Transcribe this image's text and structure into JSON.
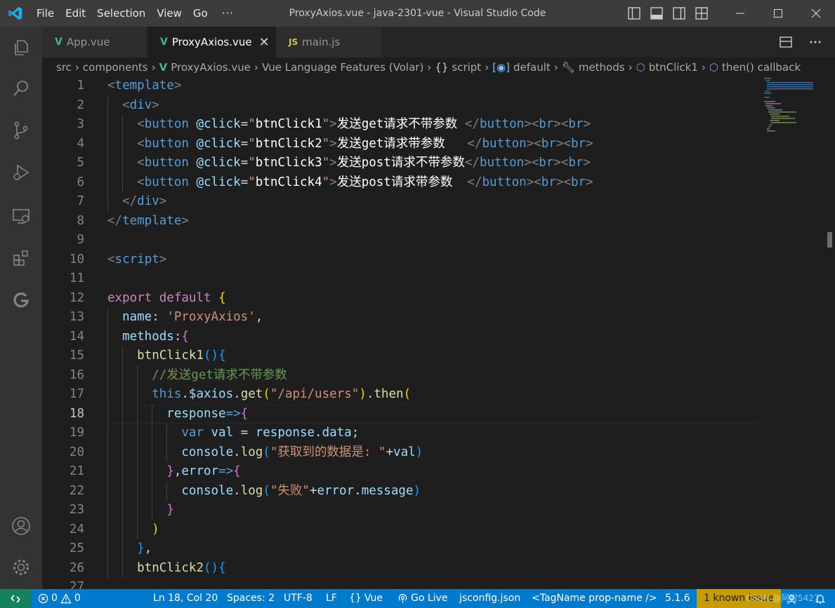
{
  "window": {
    "title": "ProxyAxios.vue - java-2301-vue - Visual Studio Code",
    "menu": [
      "File",
      "Edit",
      "Selection",
      "View",
      "Go",
      "···"
    ]
  },
  "tabs": [
    {
      "label": "App.vue",
      "icon": "vue-icon",
      "active": false
    },
    {
      "label": "ProxyAxios.vue",
      "icon": "vue-icon",
      "active": true,
      "close": "✕"
    },
    {
      "label": "main.js",
      "icon": "js-icon",
      "active": false
    }
  ],
  "breadcrumb": [
    "src",
    "components",
    "ProxyAxios.vue",
    "Vue Language Features (Volar)",
    "script",
    "default",
    "methods",
    "btnClick1",
    "then() callback"
  ],
  "editor": {
    "current_line": 18,
    "lines": [
      {
        "n": "1",
        "tokens": [
          [
            "t-punc",
            "<"
          ],
          [
            "t-tag",
            "template"
          ],
          [
            "t-punc",
            ">"
          ]
        ]
      },
      {
        "n": "2",
        "tokens": [
          [
            "t-op",
            "  "
          ],
          [
            "t-punc",
            "<"
          ],
          [
            "t-tag",
            "div"
          ],
          [
            "t-punc",
            ">"
          ]
        ]
      },
      {
        "n": "3",
        "tokens": [
          [
            "t-op",
            "    "
          ],
          [
            "t-punc",
            "<"
          ],
          [
            "t-tag",
            "button"
          ],
          [
            "t-op",
            " "
          ],
          [
            "t-attr",
            "@click"
          ],
          [
            "t-op",
            "="
          ],
          [
            "t-str",
            "\""
          ],
          [
            "t-txt",
            "btnClick1"
          ],
          [
            "t-str",
            "\""
          ],
          [
            "t-punc",
            ">"
          ],
          [
            "t-txt",
            "发送get请求不带参数 "
          ],
          [
            "t-punc",
            "</"
          ],
          [
            "t-tag",
            "button"
          ],
          [
            "t-punc",
            "><"
          ],
          [
            "t-tag",
            "br"
          ],
          [
            "t-punc",
            "><"
          ],
          [
            "t-tag",
            "br"
          ],
          [
            "t-punc",
            ">"
          ]
        ]
      },
      {
        "n": "4",
        "tokens": [
          [
            "t-op",
            "    "
          ],
          [
            "t-punc",
            "<"
          ],
          [
            "t-tag",
            "button"
          ],
          [
            "t-op",
            " "
          ],
          [
            "t-attr",
            "@click"
          ],
          [
            "t-op",
            "="
          ],
          [
            "t-str",
            "\""
          ],
          [
            "t-txt",
            "btnClick2"
          ],
          [
            "t-str",
            "\""
          ],
          [
            "t-punc",
            ">"
          ],
          [
            "t-txt",
            "发送get请求带参数   "
          ],
          [
            "t-punc",
            "</"
          ],
          [
            "t-tag",
            "button"
          ],
          [
            "t-punc",
            "><"
          ],
          [
            "t-tag",
            "br"
          ],
          [
            "t-punc",
            "><"
          ],
          [
            "t-tag",
            "br"
          ],
          [
            "t-punc",
            ">"
          ]
        ]
      },
      {
        "n": "5",
        "tokens": [
          [
            "t-op",
            "    "
          ],
          [
            "t-punc",
            "<"
          ],
          [
            "t-tag",
            "button"
          ],
          [
            "t-op",
            " "
          ],
          [
            "t-attr",
            "@click"
          ],
          [
            "t-op",
            "="
          ],
          [
            "t-str",
            "\""
          ],
          [
            "t-txt",
            "btnClick3"
          ],
          [
            "t-str",
            "\""
          ],
          [
            "t-punc",
            ">"
          ],
          [
            "t-txt",
            "发送post请求不带参数"
          ],
          [
            "t-punc",
            "</"
          ],
          [
            "t-tag",
            "button"
          ],
          [
            "t-punc",
            "><"
          ],
          [
            "t-tag",
            "br"
          ],
          [
            "t-punc",
            "><"
          ],
          [
            "t-tag",
            "br"
          ],
          [
            "t-punc",
            ">"
          ]
        ]
      },
      {
        "n": "6",
        "tokens": [
          [
            "t-op",
            "    "
          ],
          [
            "t-punc",
            "<"
          ],
          [
            "t-tag",
            "button"
          ],
          [
            "t-op",
            " "
          ],
          [
            "t-attr",
            "@click"
          ],
          [
            "t-op",
            "="
          ],
          [
            "t-str",
            "\""
          ],
          [
            "t-txt",
            "btnClick4"
          ],
          [
            "t-str",
            "\""
          ],
          [
            "t-punc",
            ">"
          ],
          [
            "t-txt",
            "发送post请求带参数  "
          ],
          [
            "t-punc",
            "</"
          ],
          [
            "t-tag",
            "button"
          ],
          [
            "t-punc",
            "><"
          ],
          [
            "t-tag",
            "br"
          ],
          [
            "t-punc",
            "><"
          ],
          [
            "t-tag",
            "br"
          ],
          [
            "t-punc",
            ">"
          ]
        ]
      },
      {
        "n": "7",
        "tokens": [
          [
            "t-op",
            "  "
          ],
          [
            "t-punc",
            "</"
          ],
          [
            "t-tag",
            "div"
          ],
          [
            "t-punc",
            ">"
          ]
        ]
      },
      {
        "n": "8",
        "tokens": [
          [
            "t-punc",
            "</"
          ],
          [
            "t-tag",
            "template"
          ],
          [
            "t-punc",
            ">"
          ]
        ]
      },
      {
        "n": "9",
        "tokens": []
      },
      {
        "n": "10",
        "tokens": [
          [
            "t-punc",
            "<"
          ],
          [
            "t-tag",
            "script"
          ],
          [
            "t-punc",
            ">"
          ]
        ]
      },
      {
        "n": "11",
        "tokens": []
      },
      {
        "n": "12",
        "tokens": [
          [
            "t-ctrl",
            "export"
          ],
          [
            "t-op",
            " "
          ],
          [
            "t-ctrl",
            "default"
          ],
          [
            "t-op",
            " "
          ],
          [
            "t-b1",
            "{"
          ]
        ]
      },
      {
        "n": "13",
        "tokens": [
          [
            "t-op",
            "  "
          ],
          [
            "t-var",
            "name"
          ],
          [
            "t-op",
            ": "
          ],
          [
            "t-str",
            "'ProxyAxios'"
          ],
          [
            "t-op",
            ","
          ]
        ]
      },
      {
        "n": "14",
        "tokens": [
          [
            "t-op",
            "  "
          ],
          [
            "t-var",
            "methods"
          ],
          [
            "t-op",
            ":"
          ],
          [
            "t-b2",
            "{"
          ]
        ]
      },
      {
        "n": "15",
        "tokens": [
          [
            "t-op",
            "    "
          ],
          [
            "t-fn",
            "btnClick1"
          ],
          [
            "t-b3",
            "()"
          ],
          [
            "t-b3",
            "{"
          ]
        ]
      },
      {
        "n": "16",
        "tokens": [
          [
            "t-op",
            "      "
          ],
          [
            "t-cmt",
            "//发送get请求不带参数"
          ]
        ]
      },
      {
        "n": "17",
        "tokens": [
          [
            "t-op",
            "      "
          ],
          [
            "t-kw",
            "this"
          ],
          [
            "t-op",
            "."
          ],
          [
            "t-var",
            "$axios"
          ],
          [
            "t-op",
            "."
          ],
          [
            "t-fn",
            "get"
          ],
          [
            "t-b1",
            "("
          ],
          [
            "t-str",
            "\"/api/users\""
          ],
          [
            "t-b1",
            ")"
          ],
          [
            "t-op",
            "."
          ],
          [
            "t-fn",
            "then"
          ],
          [
            "t-b1",
            "("
          ]
        ]
      },
      {
        "n": "18",
        "tokens": [
          [
            "t-op",
            "        "
          ],
          [
            "t-var",
            "response"
          ],
          [
            "t-kw",
            "=>"
          ],
          [
            "t-b2",
            "{"
          ]
        ]
      },
      {
        "n": "19",
        "tokens": [
          [
            "t-op",
            "          "
          ],
          [
            "t-kw",
            "var"
          ],
          [
            "t-op",
            " "
          ],
          [
            "t-var",
            "val"
          ],
          [
            "t-op",
            " = "
          ],
          [
            "t-var",
            "response"
          ],
          [
            "t-op",
            "."
          ],
          [
            "t-var",
            "data"
          ],
          [
            "t-op",
            ";"
          ]
        ]
      },
      {
        "n": "20",
        "tokens": [
          [
            "t-op",
            "          "
          ],
          [
            "t-var",
            "console"
          ],
          [
            "t-op",
            "."
          ],
          [
            "t-fn",
            "log"
          ],
          [
            "t-b3",
            "("
          ],
          [
            "t-str",
            "\"获取到的数据是: \""
          ],
          [
            "t-op",
            "+"
          ],
          [
            "t-var",
            "val"
          ],
          [
            "t-b3",
            ")"
          ]
        ]
      },
      {
        "n": "21",
        "tokens": [
          [
            "t-op",
            "        "
          ],
          [
            "t-b2",
            "}"
          ],
          [
            "t-op",
            ","
          ],
          [
            "t-var",
            "error"
          ],
          [
            "t-kw",
            "=>"
          ],
          [
            "t-b2",
            "{"
          ]
        ]
      },
      {
        "n": "22",
        "tokens": [
          [
            "t-op",
            "          "
          ],
          [
            "t-var",
            "console"
          ],
          [
            "t-op",
            "."
          ],
          [
            "t-fn",
            "log"
          ],
          [
            "t-b3",
            "("
          ],
          [
            "t-str",
            "\"失败\""
          ],
          [
            "t-op",
            "+"
          ],
          [
            "t-var",
            "error"
          ],
          [
            "t-op",
            "."
          ],
          [
            "t-var",
            "message"
          ],
          [
            "t-b3",
            ")"
          ]
        ]
      },
      {
        "n": "23",
        "tokens": [
          [
            "t-op",
            "        "
          ],
          [
            "t-b2",
            "}"
          ]
        ]
      },
      {
        "n": "24",
        "tokens": [
          [
            "t-op",
            "      "
          ],
          [
            "t-b1",
            ")"
          ]
        ]
      },
      {
        "n": "25",
        "tokens": [
          [
            "t-op",
            "    "
          ],
          [
            "t-b3",
            "}"
          ],
          [
            "t-op",
            ","
          ]
        ]
      },
      {
        "n": "26",
        "tokens": [
          [
            "t-op",
            "    "
          ],
          [
            "t-fn",
            "btnClick2"
          ],
          [
            "t-b3",
            "()"
          ],
          [
            "t-b3",
            "{"
          ]
        ]
      },
      {
        "n": "27",
        "tokens": []
      }
    ]
  },
  "statusbar": {
    "errors": "0",
    "warnings": "0",
    "position": "Ln 18, Col 20",
    "spaces": "Spaces: 2",
    "encoding": "UTF-8",
    "eol": "LF",
    "language": "Vue",
    "golive": "Go Live",
    "jsconfig": "jsconfig.json",
    "tagname": "<TagName prop-name />",
    "version": "5.1.6",
    "issue": "1 known issue",
    "watermark": "CSDN @阿智5427"
  },
  "colors": {
    "statusbar": "#007acc",
    "activitybar": "#333333",
    "titlebar": "#3c3c3c",
    "editor": "#1e1e1e"
  }
}
